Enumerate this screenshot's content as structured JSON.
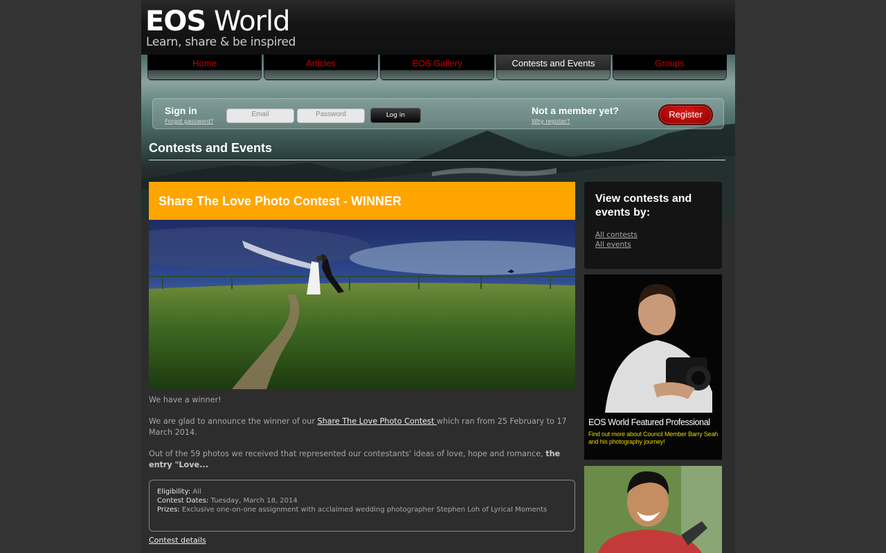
{
  "logo": {
    "title_bold": "EOS",
    "title_rest": " World",
    "tagline": "Learn, share & be inspired"
  },
  "nav": {
    "items": [
      {
        "label": "Home"
      },
      {
        "label": "Articles"
      },
      {
        "label": "EOS Gallery"
      },
      {
        "label": "Contests and Events"
      },
      {
        "label": "Groups"
      }
    ],
    "active": "Contests and Events"
  },
  "signin": {
    "title": "Sign in",
    "forgot": "Forgot password?",
    "email_placeholder": "Email",
    "password_placeholder": "Password",
    "login_label": "Log in",
    "member_title": "Not a member yet?",
    "why_register": "Why register?",
    "register_label": "Register"
  },
  "page": {
    "title": "Contests and Events"
  },
  "contest": {
    "title": "Share The Love Photo Contest - WINNER",
    "p1": "We have a winner!",
    "p2_before": "We are glad to announce the winner of our ",
    "p2_link": "Share The Love Photo Contest ",
    "p2_after": "which ran from 25 February to 17 March 2014.",
    "p3_before": "Out of the 59 photos we received that represented our contestants' ideas of love, hope and  romance, ",
    "p3_bold": "the entry \"Love...",
    "info": {
      "eligibility_label": "Eligibility:",
      "eligibility_value": "All",
      "dates_label": "Contest Dates:",
      "dates_value": "Tuesday, March 18, 2014",
      "prizes_label": "Prizes:",
      "prizes_value": "Exclusive one-on-one assignment with acclaimed wedding photographer Stephen Loh of Lyrical Moments"
    },
    "details_link": "Contest details"
  },
  "sidebar": {
    "view_title": "View contests and events by:",
    "all_contests": "All contests",
    "all_events": "All events",
    "featured_title": "EOS World Featured Professional",
    "featured_sub": "Find out more about Council Member Barry Seah and his photography journey!"
  },
  "colors": {
    "accent_orange": "#ffa500",
    "nav_red": "#c80000",
    "register_red": "#cc0000",
    "featured_yellow": "#e5d400"
  }
}
